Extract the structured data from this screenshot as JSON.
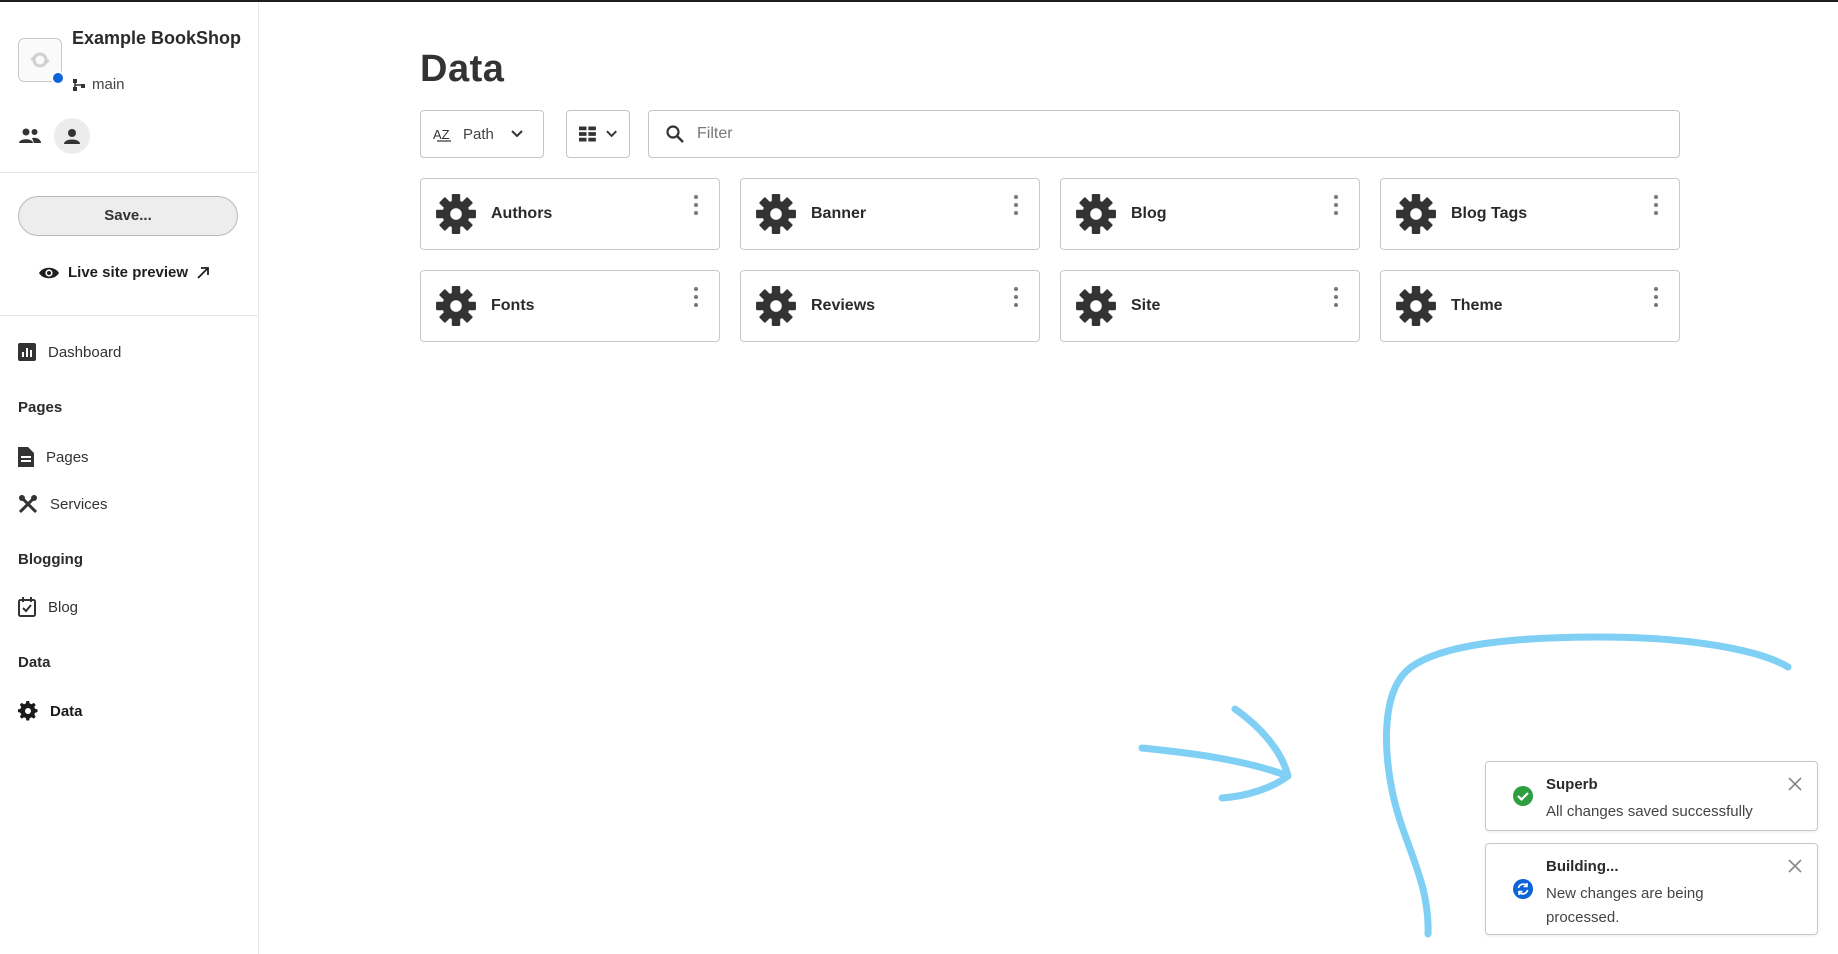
{
  "site": {
    "name": "Example BookShop",
    "branch": "main"
  },
  "sidebar": {
    "save_label": "Save...",
    "live_preview_label": "Live site preview",
    "dashboard_label": "Dashboard",
    "sections": [
      {
        "heading": "Pages",
        "items": [
          "Pages",
          "Services"
        ]
      },
      {
        "heading": "Blogging",
        "items": [
          "Blog"
        ]
      },
      {
        "heading": "Data",
        "items": [
          "Data"
        ]
      }
    ],
    "active_item": "Data"
  },
  "main": {
    "title": "Data",
    "sort_label": "Path",
    "filter_placeholder": "Filter",
    "cards": [
      "Authors",
      "Banner",
      "Blog",
      "Blog Tags",
      "Fonts",
      "Reviews",
      "Site",
      "Theme"
    ]
  },
  "toasts": [
    {
      "title": "Superb",
      "body": "All changes saved successfully",
      "status": "success"
    },
    {
      "title": "Building...",
      "body": "New changes are being processed.",
      "status": "info"
    }
  ],
  "colors": {
    "accent": "#0d63d8",
    "success": "#2e9e3f",
    "annotation": "#7fd0f4"
  },
  "icons": {
    "sort": "az-sort-icon",
    "view": "grid-view-icon",
    "search": "search-icon",
    "card": "gear-icon",
    "more": "kebab-menu-icon"
  }
}
